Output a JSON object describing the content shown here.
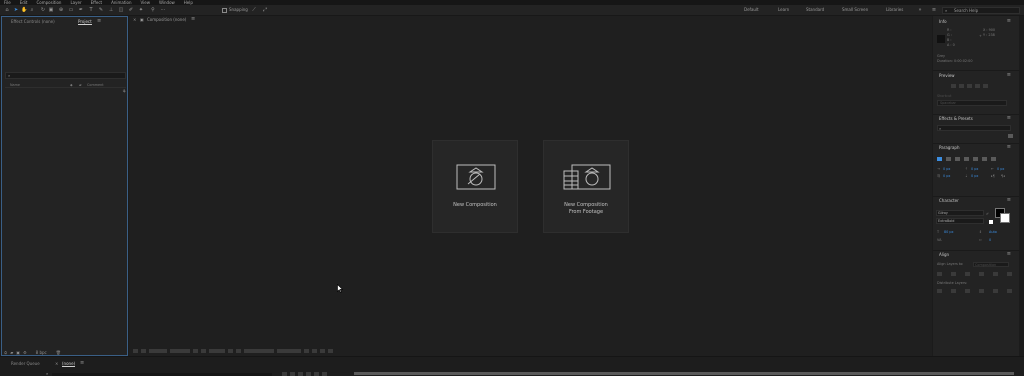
{
  "menu": [
    "File",
    "Edit",
    "Composition",
    "Layer",
    "Effect",
    "Animation",
    "View",
    "Window",
    "Help"
  ],
  "toolbar": {
    "snapping_label": "Snapping",
    "workspaces": [
      "Default",
      "Learn",
      "Standard",
      "Small Screen",
      "Libraries"
    ],
    "search_placeholder": "Search Help"
  },
  "left_panel": {
    "tabs": [
      "Effect Controls (none)",
      "Project"
    ],
    "columns": [
      "Name",
      "Comment"
    ],
    "footer_bpc": "8 bpc"
  },
  "composition": {
    "tab_label": "Composition (none)",
    "cards": [
      {
        "label_line1": "New Composition",
        "label_line2": ""
      },
      {
        "label_line1": "New Composition",
        "label_line2": "From Footage"
      }
    ]
  },
  "bottom": {
    "tabs": [
      "Render Queue",
      "(none)"
    ]
  },
  "info": {
    "title": "Info",
    "r": "R :",
    "g": "G :",
    "b": "B :",
    "a": "A : 0",
    "x": "X : 900",
    "y": "Y : 238",
    "line1": "Grey",
    "line2": "Duration: 0:00:02:00"
  },
  "preview": {
    "title": "Preview",
    "shortcut_label": "Shortcut",
    "shortcut_value": "Spacebar"
  },
  "effects": {
    "title": "Effects & Presets"
  },
  "paragraph": {
    "title": "Paragraph",
    "values": [
      "0 px",
      "0 px",
      "0 px",
      "0 px",
      "0 px"
    ]
  },
  "character": {
    "title": "Character",
    "font": "Gilroy",
    "style": "ExtraBold",
    "size": "80 px",
    "leading": "Auto",
    "tracking": "0"
  },
  "align": {
    "title": "Align",
    "align_layers_to": "Align Layers to:",
    "align_target": "Composition",
    "distribute_layers": "Distribute Layers:"
  },
  "colors": {
    "accent": "#3b8de0",
    "bg": "#1b1b1b",
    "panel": "#232323"
  }
}
